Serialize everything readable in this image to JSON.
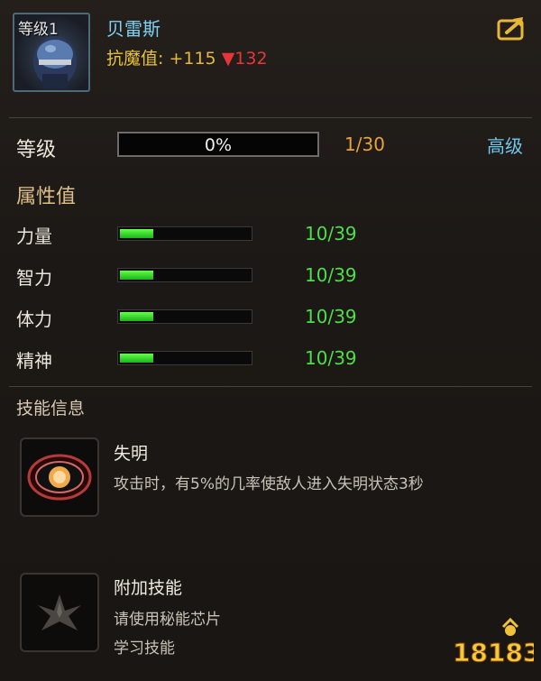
{
  "header": {
    "level_tag": "等级1",
    "item_name": "贝雷斯",
    "stat_label": "抗魔值:",
    "stat_plus": "+115",
    "stat_minus": "▼132"
  },
  "level": {
    "label": "等级",
    "percent_text": "0%",
    "count": "1/30",
    "advanced": "高级"
  },
  "attributes": {
    "title": "属性值",
    "items": [
      {
        "name": "力量",
        "value": "10/39",
        "fill": 0.26
      },
      {
        "name": "智力",
        "value": "10/39",
        "fill": 0.26
      },
      {
        "name": "体力",
        "value": "10/39",
        "fill": 0.26
      },
      {
        "name": "精神",
        "value": "10/39",
        "fill": 0.26
      }
    ]
  },
  "skills": {
    "title": "技能信息",
    "skill1": {
      "name": "失明",
      "desc": "攻击时，有5%的几率使敌人进入失明状态3秒",
      "icon": "eye-icon"
    },
    "skill2": {
      "name": "附加技能",
      "desc1": "请使用秘能芯片",
      "desc2": "学习技能",
      "icon": "wing-emblem-icon"
    }
  },
  "watermark": "18183",
  "colors": {
    "name": "#7fd0f2",
    "stat": "#e8c33b",
    "down": "#e8353a",
    "count": "#e8a23a",
    "advanced": "#6fc8ea",
    "green": "#4ede4a"
  }
}
